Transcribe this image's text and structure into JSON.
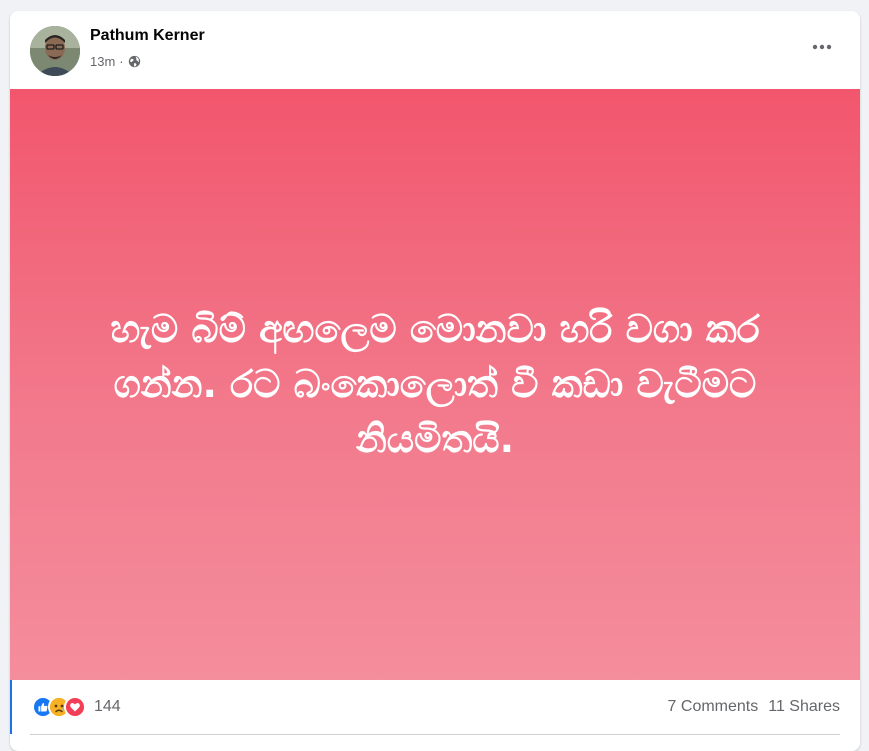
{
  "post": {
    "author": "Pathum Kerner",
    "time": "13m",
    "privacy_icon": "globe-icon",
    "menu_icon": "more-options-icon",
    "message": "හැම බිම් අඟලෙම මොනවා හරි වගා කර ගන්න. රට බංකොලොත් වී කඩා වැටීමට නියමිතයි.",
    "background_gradient": [
      "#f2566d",
      "#f48d9c"
    ]
  },
  "footer": {
    "reactions": [
      "like-icon",
      "sad-icon",
      "love-icon"
    ],
    "reaction_count": "144",
    "comments": "7 Comments",
    "shares": "11 Shares"
  },
  "colors": {
    "like": "#1877f2",
    "sad": "#f7b125",
    "love": "#f33e58",
    "secondary_text": "#65676b"
  }
}
